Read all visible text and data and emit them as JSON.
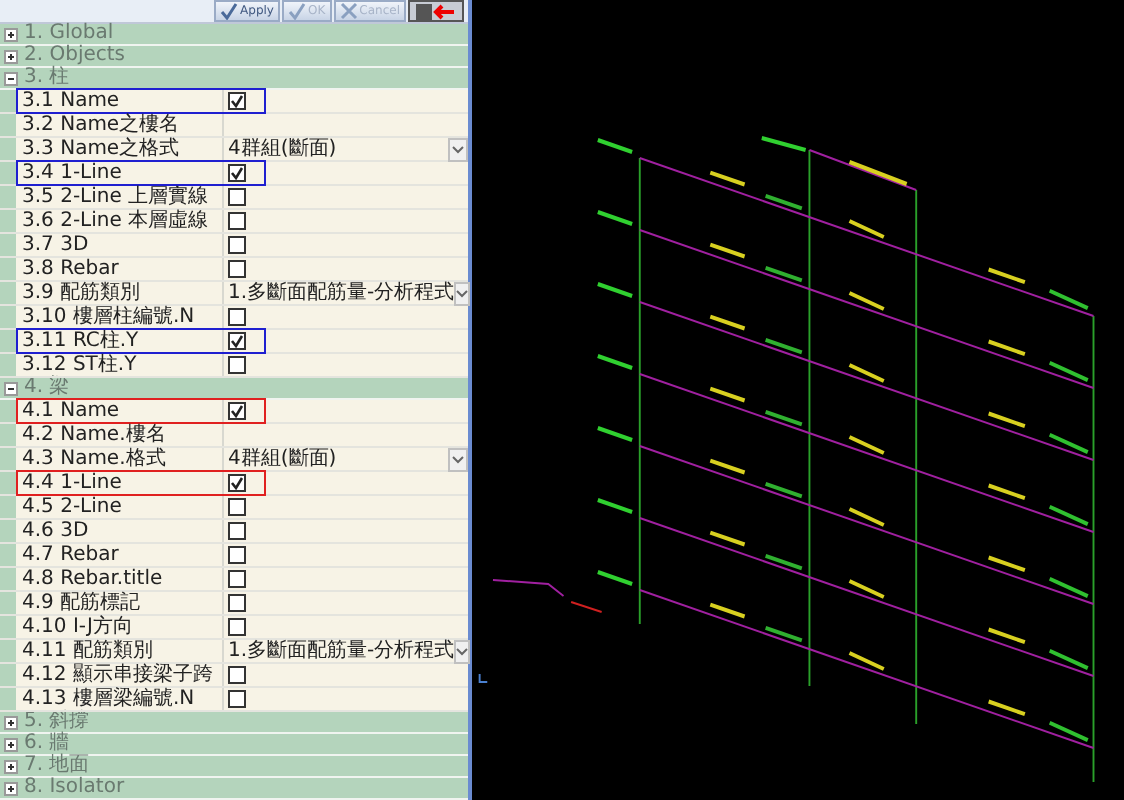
{
  "toolbar": {
    "buttons": [
      {
        "kind": "apply",
        "label": "Apply",
        "disabled": false
      },
      {
        "kind": "ok",
        "label": "OK",
        "disabled": true
      },
      {
        "kind": "cancel",
        "label": "Cancel",
        "disabled": true
      },
      {
        "kind": "exit"
      }
    ]
  },
  "categories": [
    {
      "label": "1. Global",
      "expanded": false
    },
    {
      "label": "2. Objects",
      "expanded": false
    },
    {
      "label": "3. 柱",
      "expanded": true,
      "items": [
        {
          "label": "3.1 Name",
          "kind": "checkbox",
          "checked": true,
          "color": "#1f1fd0"
        },
        {
          "label": "3.2 Name之樓名",
          "kind": "text"
        },
        {
          "label": "3.3 Name之格式",
          "kind": "dropdown",
          "value": "4群組(斷面)"
        },
        {
          "label": "3.4 1-Line",
          "kind": "checkbox",
          "checked": true,
          "color": "#1f1fd0"
        },
        {
          "label": "3.5 2-Line 上層實線",
          "kind": "checkbox",
          "checked": false
        },
        {
          "label": "3.6 2-Line 本層虛線",
          "kind": "checkbox",
          "checked": false
        },
        {
          "label": "3.7 3D",
          "kind": "checkbox",
          "checked": false
        },
        {
          "label": "3.8 Rebar",
          "kind": "checkbox",
          "checked": false
        },
        {
          "label": "3.9 配筋類別",
          "kind": "dropdown",
          "value": "1.多斷面配筋量-分析程式"
        },
        {
          "label": "3.10 樓層柱編號.N",
          "kind": "checkbox",
          "checked": false
        },
        {
          "label": "3.11 RC柱.Y",
          "kind": "checkbox",
          "checked": true,
          "color": "#1f1fd0"
        },
        {
          "label": "3.12 ST柱.Y",
          "kind": "checkbox",
          "checked": false
        }
      ]
    },
    {
      "label": "4. 梁",
      "expanded": true,
      "items": [
        {
          "label": "4.1 Name",
          "kind": "checkbox",
          "checked": true,
          "color": "#e02020"
        },
        {
          "label": "4.2 Name.樓名",
          "kind": "text"
        },
        {
          "label": "4.3 Name.格式",
          "kind": "dropdown",
          "value": "4群組(斷面)"
        },
        {
          "label": "4.4 1-Line",
          "kind": "checkbox",
          "checked": true,
          "color": "#e02020"
        },
        {
          "label": "4.5 2-Line",
          "kind": "checkbox",
          "checked": false
        },
        {
          "label": "4.6 3D",
          "kind": "checkbox",
          "checked": false
        },
        {
          "label": "4.7 Rebar",
          "kind": "checkbox",
          "checked": false
        },
        {
          "label": "4.8 Rebar.title",
          "kind": "checkbox",
          "checked": false
        },
        {
          "label": "4.9 配筋標記",
          "kind": "checkbox",
          "checked": false
        },
        {
          "label": "4.10 I-J方向",
          "kind": "checkbox",
          "checked": false
        },
        {
          "label": "4.11 配筋類別",
          "kind": "dropdown",
          "value": "1.多斷面配筋量-分析程式"
        },
        {
          "label": "4.12 顯示串接梁子跨",
          "kind": "checkbox",
          "checked": false
        },
        {
          "label": "4.13 樓層梁編號.N",
          "kind": "checkbox",
          "checked": false
        }
      ]
    },
    {
      "label": "5. 斜撐",
      "expanded": false
    },
    {
      "label": "6. 牆",
      "expanded": false
    },
    {
      "label": "7. 地面",
      "expanded": false
    },
    {
      "label": "8. Isolator",
      "expanded": false
    }
  ]
}
